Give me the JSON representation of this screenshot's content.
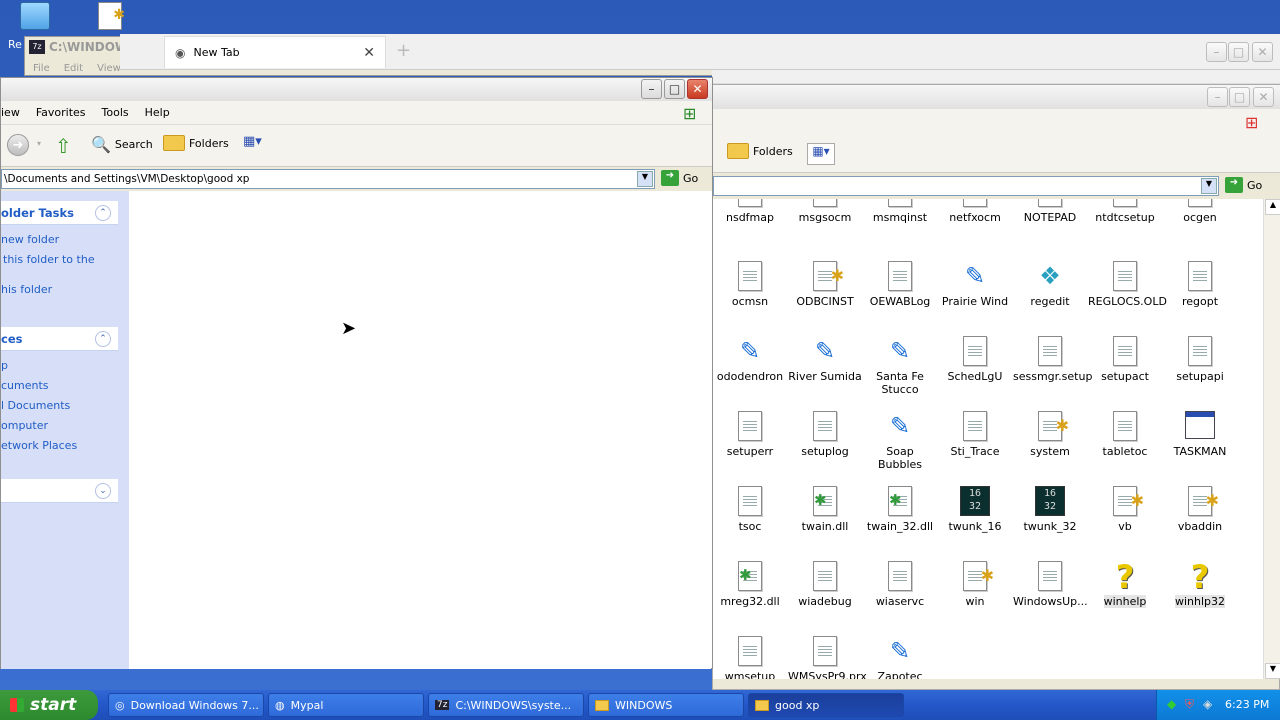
{
  "desktop": {
    "recycle_label": "Re",
    "notepad_icon": "notepad-icon"
  },
  "cmd_window": {
    "title": "C:\\WINDOW",
    "menu": [
      "File",
      "Edit",
      "View"
    ]
  },
  "browser": {
    "tab_label": "New Tab"
  },
  "windows_folder": {
    "toolbar_folders": "Folders",
    "go_label": "Go",
    "icons": [
      {
        "label": "nsdfmap",
        "type": "doc"
      },
      {
        "label": "msgsocm",
        "type": "doc"
      },
      {
        "label": "msmqinst",
        "type": "doc"
      },
      {
        "label": "netfxocm",
        "type": "doc"
      },
      {
        "label": "NOTEPAD",
        "type": "doc"
      },
      {
        "label": "ntdtcsetup",
        "type": "doc"
      },
      {
        "label": "ocgen",
        "type": "doc"
      },
      {
        "label": "ocmsn",
        "type": "doc"
      },
      {
        "label": "ODBCINST",
        "type": "cfg"
      },
      {
        "label": "OEWABLog",
        "type": "doc"
      },
      {
        "label": "Prairie Wind",
        "type": "paint"
      },
      {
        "label": "regedit",
        "type": "reg"
      },
      {
        "label": "REGLOCS.OLD",
        "type": "doc"
      },
      {
        "label": "regopt",
        "type": "doc"
      },
      {
        "label": "ododendron",
        "type": "paint"
      },
      {
        "label": "River Sumida",
        "type": "paint"
      },
      {
        "label": "Santa Fe Stucco",
        "type": "paint"
      },
      {
        "label": "SchedLgU",
        "type": "doc"
      },
      {
        "label": "sessmgr.setup",
        "type": "doc"
      },
      {
        "label": "setupact",
        "type": "doc"
      },
      {
        "label": "setupapi",
        "type": "doc"
      },
      {
        "label": "setuperr",
        "type": "doc"
      },
      {
        "label": "setuplog",
        "type": "doc"
      },
      {
        "label": "Soap Bubbles",
        "type": "paint"
      },
      {
        "label": "Sti_Trace",
        "type": "doc"
      },
      {
        "label": "system",
        "type": "cfg"
      },
      {
        "label": "tabletoc",
        "type": "doc"
      },
      {
        "label": "TASKMAN",
        "type": "taskman"
      },
      {
        "label": "tsoc",
        "type": "doc"
      },
      {
        "label": "twain.dll",
        "type": "dll"
      },
      {
        "label": "twain_32.dll",
        "type": "dll"
      },
      {
        "label": "twunk_16",
        "type": "bin"
      },
      {
        "label": "twunk_32",
        "type": "bin"
      },
      {
        "label": "vb",
        "type": "cfg"
      },
      {
        "label": "vbaddin",
        "type": "cfg"
      },
      {
        "label": "mreg32.dll",
        "type": "dll"
      },
      {
        "label": "wiadebug",
        "type": "doc"
      },
      {
        "label": "wiaservc",
        "type": "doc"
      },
      {
        "label": "win",
        "type": "cfg"
      },
      {
        "label": "WindowsUp...",
        "type": "doc"
      },
      {
        "label": "winhelp",
        "type": "help"
      },
      {
        "label": "winhlp32",
        "type": "help"
      },
      {
        "label": "wmsetup",
        "type": "doc"
      },
      {
        "label": "WMSysPr9.prx",
        "type": "doc"
      },
      {
        "label": "Zapotec",
        "type": "paint"
      }
    ]
  },
  "front_window": {
    "menu": [
      "iew",
      "Favorites",
      "Tools",
      "Help"
    ],
    "toolbar": {
      "search": "Search",
      "folders": "Folders"
    },
    "address": "\\Documents and Settings\\VM\\Desktop\\good xp",
    "go_label": "Go",
    "folder_tasks": {
      "title": "older Tasks",
      "items": [
        "new folder",
        "this folder to the",
        "his folder"
      ]
    },
    "other_places": {
      "title": "ces",
      "items": [
        "p",
        "cuments",
        "l Documents",
        "omputer",
        "etwork Places"
      ]
    }
  },
  "taskbar": {
    "start_label": "start",
    "tasks": [
      {
        "label": "Download Windows 7...",
        "icon": "web-icon"
      },
      {
        "label": "Mypal",
        "icon": "browser-icon"
      },
      {
        "label": "C:\\WINDOWS\\syste...",
        "icon": "archive-icon"
      },
      {
        "label": "WINDOWS",
        "icon": "folder-icon"
      },
      {
        "label": "good xp",
        "icon": "folder-icon"
      }
    ],
    "clock": "6:23 PM"
  },
  "colors": {
    "desktop": "#3b6fd0",
    "taskbar": "#2457c8",
    "start": "#2e8a2e",
    "panel": "#d6dff7"
  }
}
